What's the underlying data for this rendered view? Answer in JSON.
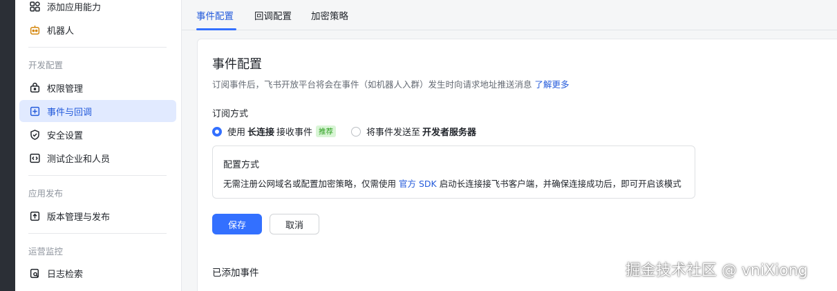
{
  "sidebar": {
    "items_top": [
      {
        "label": "添加应用能力",
        "icon": "apps-icon"
      },
      {
        "label": "机器人",
        "icon": "robot-icon"
      }
    ],
    "sections": [
      {
        "label": "开发配置",
        "items": [
          {
            "label": "权限管理",
            "icon": "lock-icon"
          },
          {
            "label": "事件与回调",
            "icon": "event-icon",
            "active": true
          },
          {
            "label": "安全设置",
            "icon": "shield-icon"
          },
          {
            "label": "测试企业和人员",
            "icon": "code-icon"
          }
        ]
      },
      {
        "label": "应用发布",
        "items": [
          {
            "label": "版本管理与发布",
            "icon": "upload-icon"
          }
        ]
      },
      {
        "label": "运营监控",
        "items": [
          {
            "label": "日志检索",
            "icon": "log-search-icon"
          }
        ]
      }
    ]
  },
  "tabs": [
    {
      "label": "事件配置",
      "active": true
    },
    {
      "label": "回调配置"
    },
    {
      "label": "加密策略"
    }
  ],
  "card": {
    "title": "事件配置",
    "desc": "订阅事件后，飞书开放平台将会在事件（如机器人入群）发生时向请求地址推送消息",
    "learn_more": "了解更多",
    "subscribe_label": "订阅方式",
    "option1": {
      "pre": "使用",
      "bold": "长连接",
      "post": "接收事件",
      "badge": "推荐",
      "checked": true
    },
    "option2": {
      "pre": "将事件发送至",
      "bold": "开发者服务器",
      "checked": false
    },
    "info": {
      "title": "配置方式",
      "text_pre": "无需注册公网域名或配置加密策略，仅需使用",
      "link": "官方 SDK",
      "text_post": "启动长连接接飞书客户端，并确保连接成功后，即可开启该模式"
    },
    "save": "保存",
    "cancel": "取消",
    "added_events": "已添加事件"
  },
  "watermark": "掘金技术社区 @ vniXiong",
  "colors": {
    "primary": "#3370ff",
    "active_bg": "#e1eaff",
    "link": "#245bdb"
  }
}
